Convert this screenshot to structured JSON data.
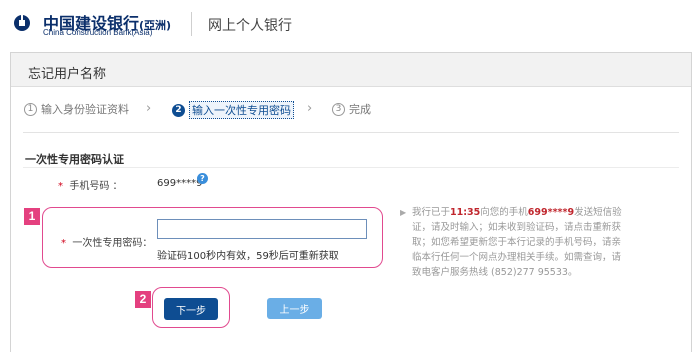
{
  "header": {
    "logo_icon": "ccb-logo-icon",
    "brand_cn": "中国建设银行",
    "brand_cn_suffix": "(亞洲)",
    "brand_en": "China Construction Bank(Asia)",
    "service_title": "网上个人银行",
    "brand_color": "#0b2f6b"
  },
  "panel": {
    "title": "忘记用户名称"
  },
  "steps": [
    {
      "num": "1",
      "label": "输入身份验证资料",
      "active": false
    },
    {
      "num": "2",
      "label": "输入一次性专用密码",
      "active": true
    },
    {
      "num": "3",
      "label": "完成",
      "active": false
    }
  ],
  "section": {
    "title": "一次性专用密码认证"
  },
  "form": {
    "required_mark": "*",
    "phone_label": "手机号码 ：",
    "phone_value": "699****9",
    "help_icon": "question-icon",
    "otp_label": "一次性专用密码：",
    "otp_value": "",
    "otp_placeholder": "",
    "otp_hint": "验证码100秒内有效，59秒后可重新获取"
  },
  "info": {
    "text_before": "我行已于",
    "time": "11:35",
    "text_mid": "向您的手机",
    "phone": "699****9",
    "text_after": "发送短信验证，请及时输入；如未收到验证码，请点击重新获取；如您希望更新您于本行记录的手机号码，请亲临本行任何一个网点办理相关手续。如需查询，请致电客户服务热线 (852)277 95533。",
    "highlight_color": "#c0262d"
  },
  "annotations": {
    "badge_1": "1",
    "badge_2": "2",
    "color": "#e4407f"
  },
  "buttons": {
    "next": "下一步",
    "prev": "上一步",
    "next_color": "#0e4d92",
    "prev_color": "#6aaee6"
  }
}
